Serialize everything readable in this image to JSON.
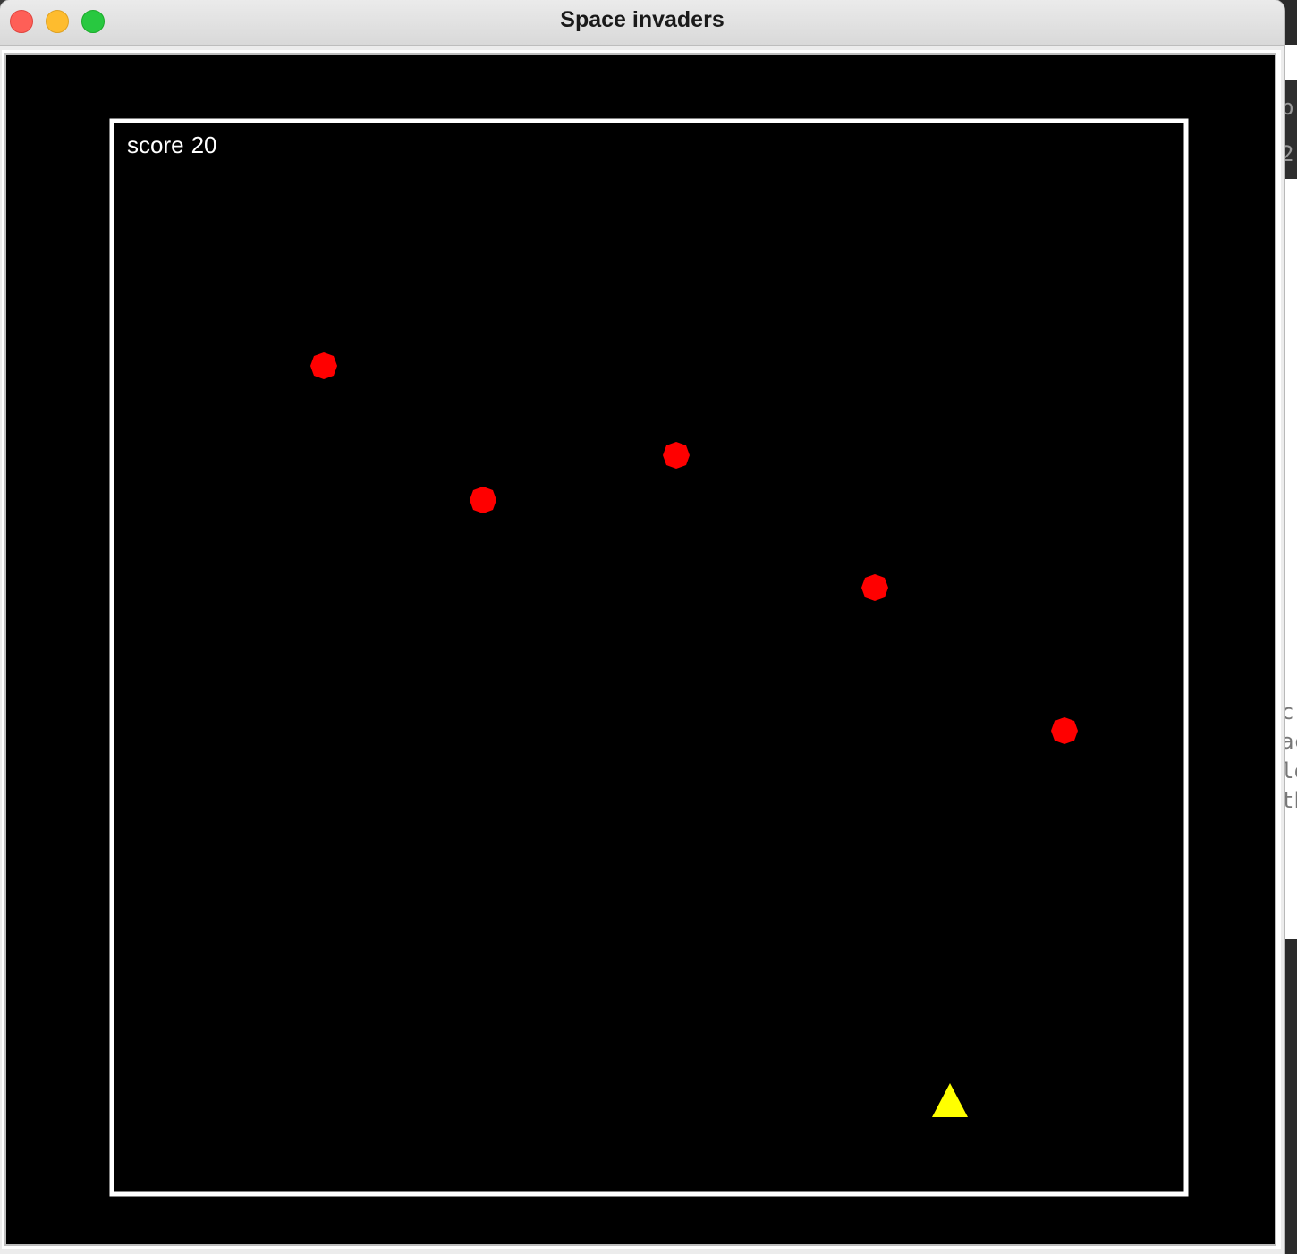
{
  "window": {
    "title": "Space invaders"
  },
  "game": {
    "score_label": "score",
    "score": 20,
    "colors": {
      "background": "#000000",
      "border": "#ffffff",
      "invader": "#ff0000",
      "player": "#ffff00",
      "text": "#ffffff"
    },
    "invader_shape": "octagon",
    "player_shape": "triangle"
  },
  "background_app": {
    "text_lines": [
      "c",
      "ac",
      "lo",
      "th"
    ],
    "top_fragments": [
      "p",
      "2"
    ]
  }
}
